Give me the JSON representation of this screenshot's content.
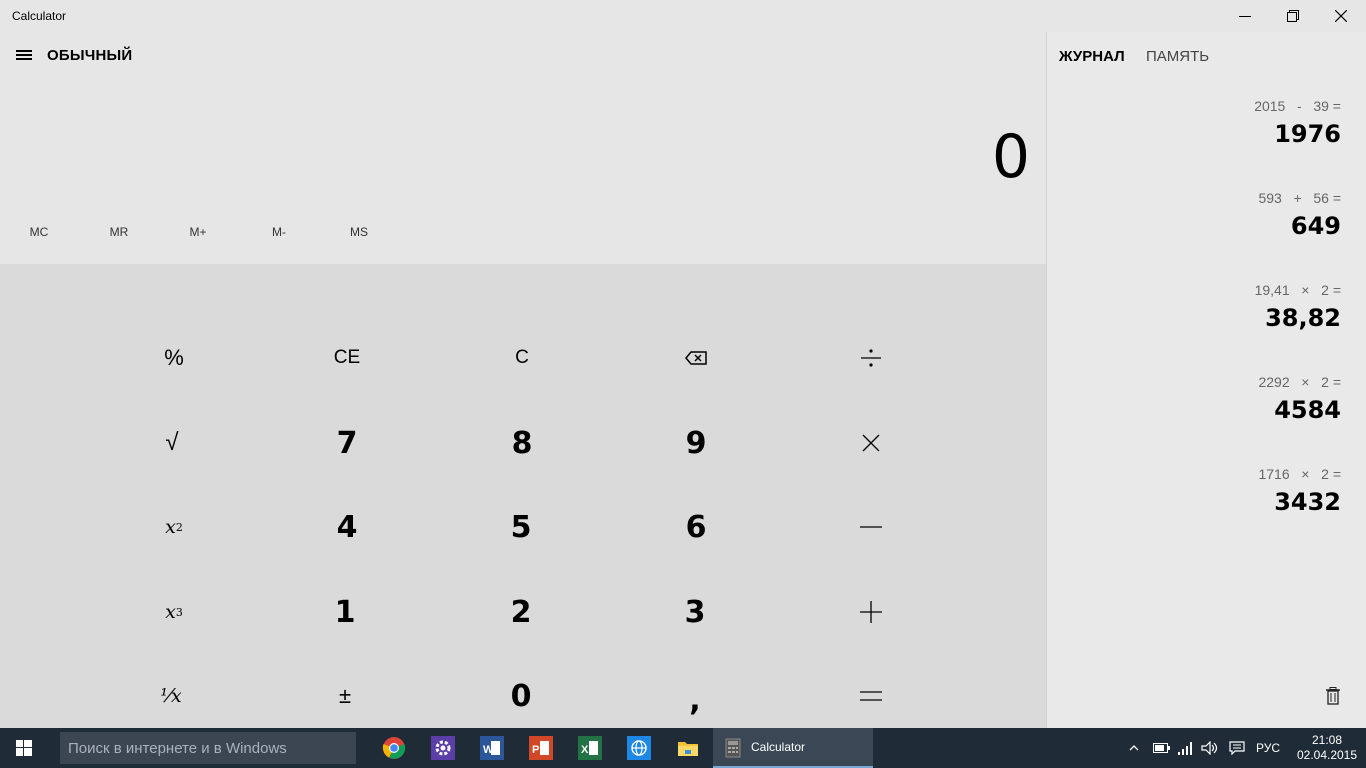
{
  "window": {
    "title": "Calculator"
  },
  "header": {
    "mode": "ОБЫЧНЫЙ"
  },
  "display": {
    "value": "0"
  },
  "memory_buttons": [
    "MC",
    "MR",
    "M+",
    "M-",
    "MS"
  ],
  "keys": {
    "percent": "%",
    "ce": "CE",
    "c": "C",
    "sqrt": "√",
    "n7": "7",
    "n8": "8",
    "n9": "9",
    "x2_base": "x",
    "x2_exp": "2",
    "n4": "4",
    "n5": "5",
    "n6": "6",
    "x3_base": "x",
    "x3_exp": "3",
    "n1": "1",
    "n2": "2",
    "n3": "3",
    "reciprocal": "¹⁄x",
    "negate": "±",
    "n0": "0",
    "decimal": ","
  },
  "sidebar": {
    "tabs": [
      "ЖУРНАЛ",
      "ПАМЯТЬ"
    ],
    "history": [
      {
        "expr": "2015   -   39 =",
        "result": "1976"
      },
      {
        "expr": "593   +   56 =",
        "result": "649"
      },
      {
        "expr": "19,41   ×   2 =",
        "result": "38,82"
      },
      {
        "expr": "2292   ×   2 =",
        "result": "4584"
      },
      {
        "expr": "1716   ×   2 =",
        "result": "3432"
      }
    ]
  },
  "taskbar": {
    "search_placeholder": "Поиск в интернете и в Windows",
    "active_app": "Calculator",
    "language": "РУС",
    "time": "21:08",
    "date": "02.04.2015"
  },
  "colors": {
    "accent": "#7aa6d3",
    "taskbar": "#1f2b36"
  }
}
